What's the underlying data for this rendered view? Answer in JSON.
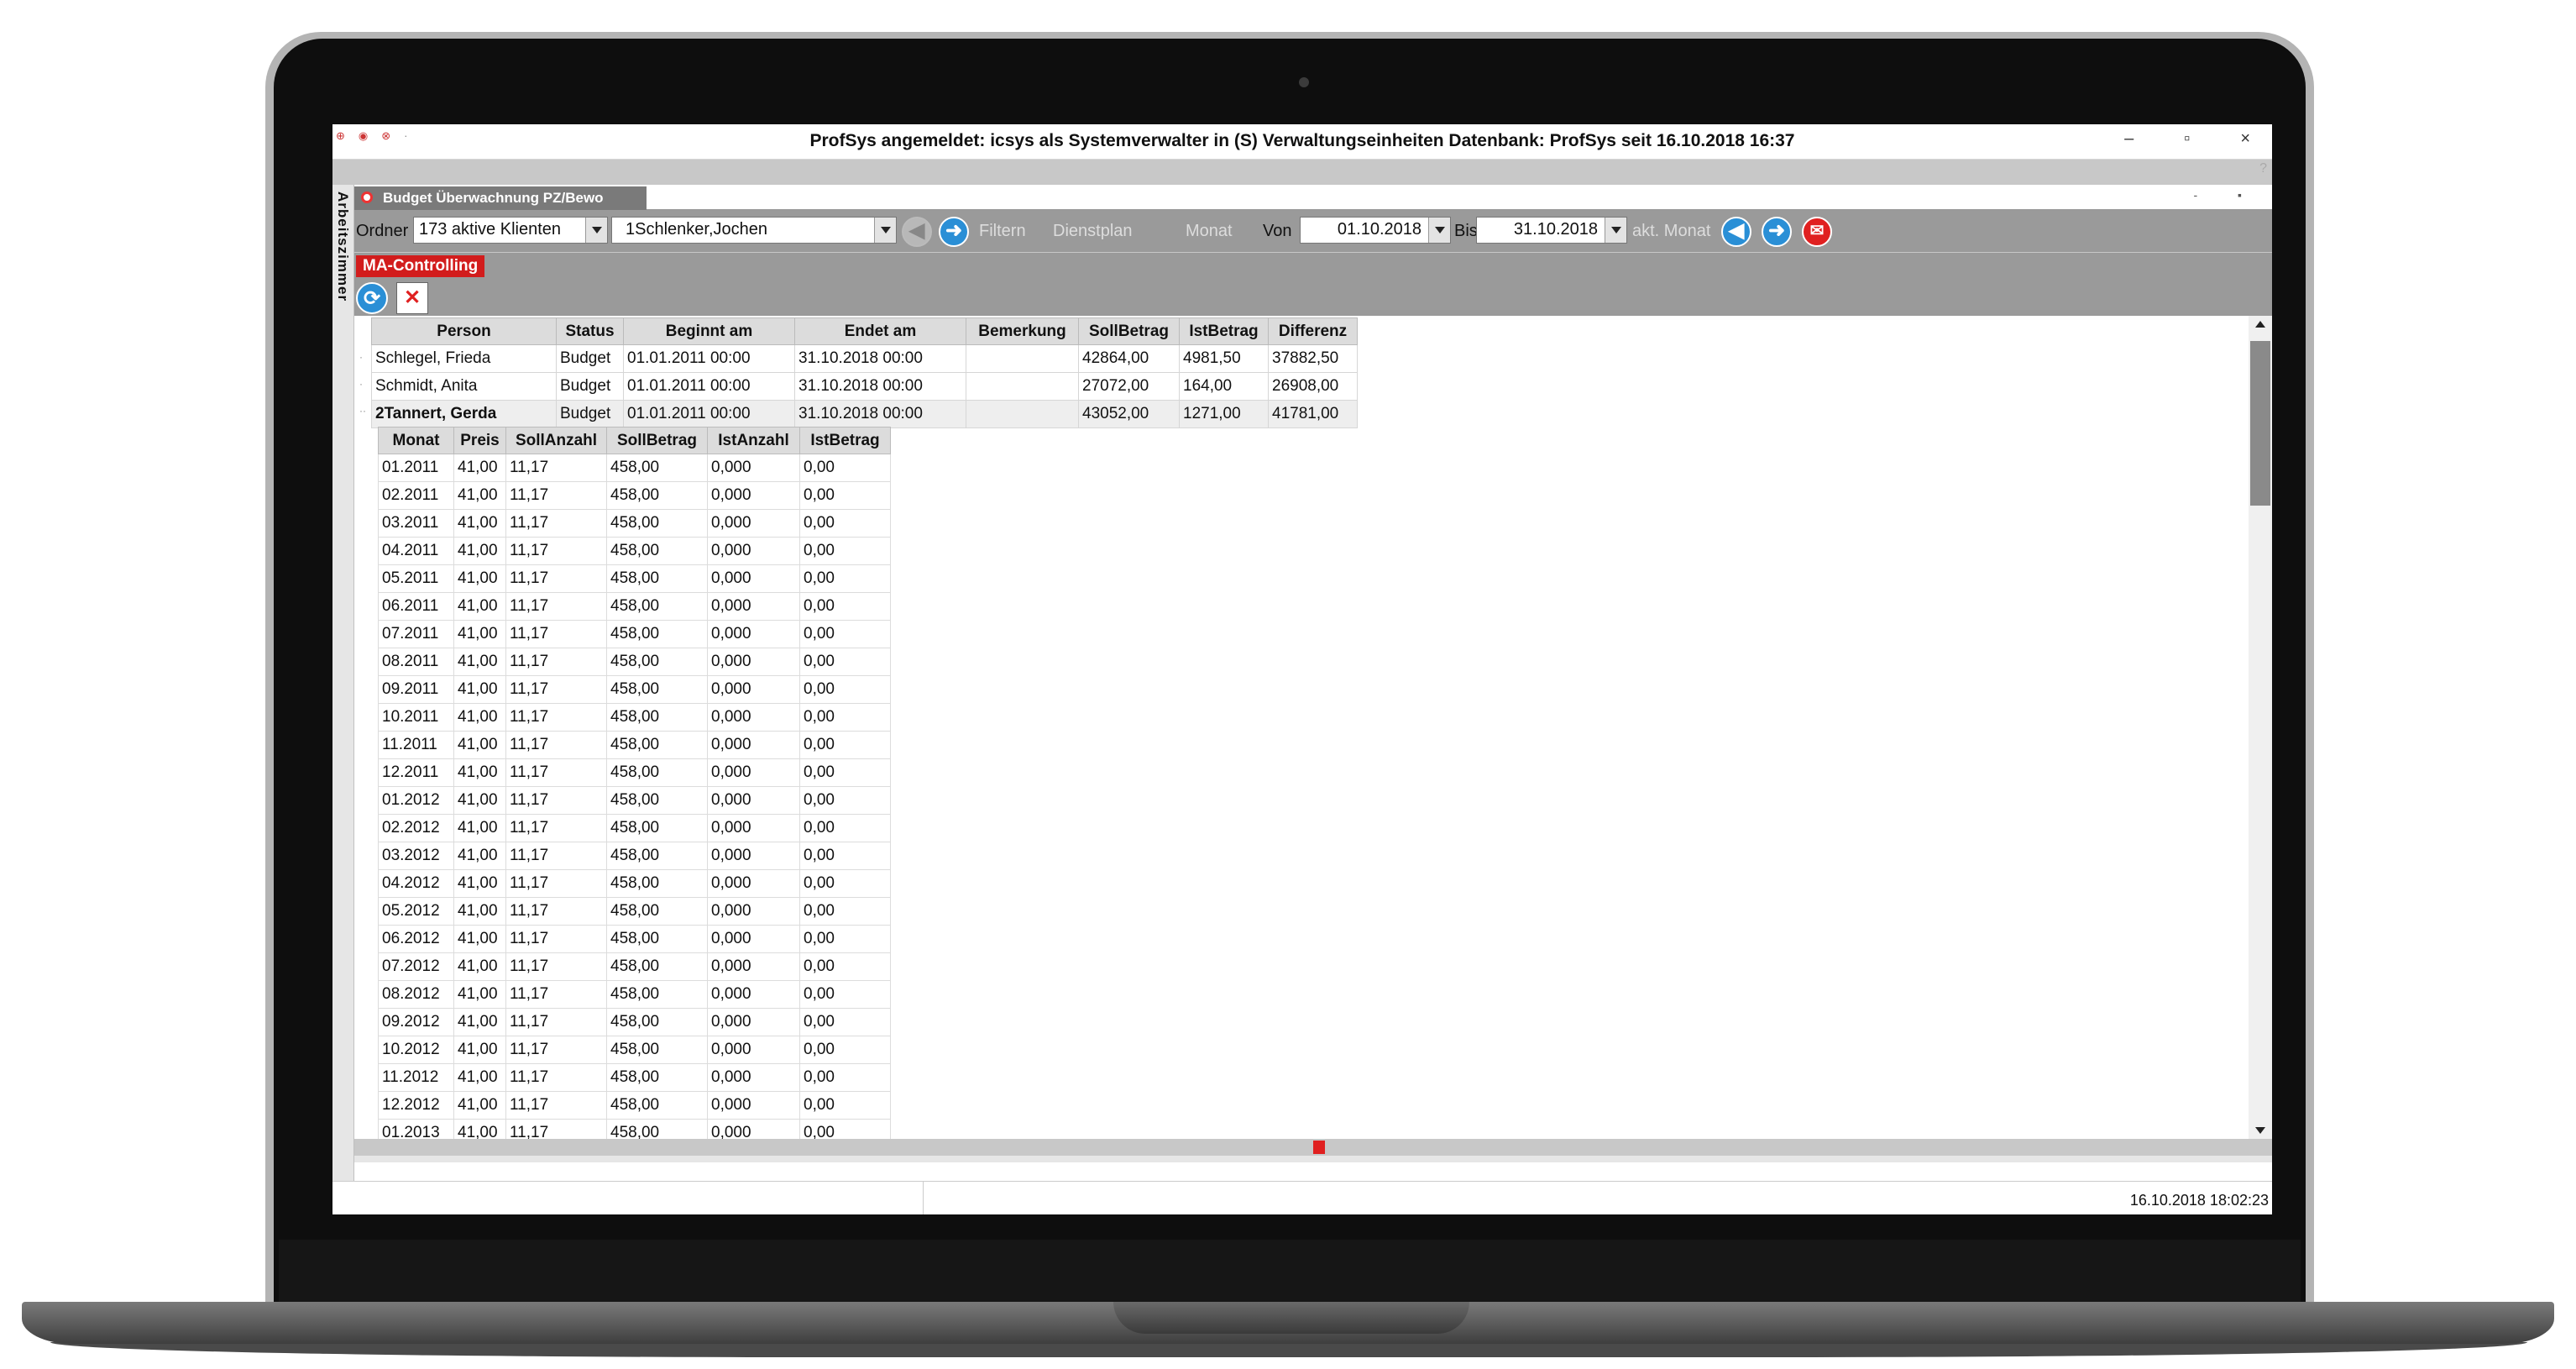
{
  "window": {
    "title": "ProfSys angemeldet: icsys als Systemverwalter in (S) Verwaltungseinheiten Datenbank: ProfSys seit 16.10.2018 16:37",
    "minimize": "–",
    "restore": "▫",
    "close": "×"
  },
  "sidebar": {
    "label": "Arbeitszimmer"
  },
  "document_tab": {
    "label": "Budget Überwachnung PZ/Bewo"
  },
  "toolbar": {
    "ordner_label": "Ordner",
    "ordner_value": "173 aktive Klienten",
    "person_value": "1Schlenker,Jochen",
    "filter_label": "Filtern",
    "dienstplan_label": "Dienstplan",
    "monat_label": "Monat",
    "von_label": "Von",
    "von_value": "01.10.2018",
    "bis_label": "Bis",
    "bis_value": "31.10.2018",
    "akt_monat_label": "akt. Monat"
  },
  "badge": {
    "label": "MA-Controlling"
  },
  "person_table": {
    "columns": [
      "Person",
      "Status",
      "Beginnt am",
      "Endet am",
      "Bemerkung",
      "SollBetrag",
      "IstBetrag",
      "Differenz"
    ],
    "rows": [
      [
        "Schlegel, Frieda",
        "Budget",
        "01.01.2011 00:00",
        "31.10.2018 00:00",
        "",
        "42864,00",
        "4981,50",
        "37882,50"
      ],
      [
        "Schmidt, Anita",
        "Budget",
        "01.01.2011 00:00",
        "31.10.2018 00:00",
        "",
        "27072,00",
        "164,00",
        "26908,00"
      ],
      [
        "2Tannert, Gerda",
        "Budget",
        "01.01.2011 00:00",
        "31.10.2018 00:00",
        "",
        "43052,00",
        "1271,00",
        "41781,00"
      ]
    ]
  },
  "month_table": {
    "columns": [
      "Monat",
      "Preis",
      "SollAnzahl",
      "SollBetrag",
      "IstAnzahl",
      "IstBetrag"
    ],
    "rows": [
      [
        "01.2011",
        "41,00",
        "11,17",
        "458,00",
        "0,000",
        "0,00"
      ],
      [
        "02.2011",
        "41,00",
        "11,17",
        "458,00",
        "0,000",
        "0,00"
      ],
      [
        "03.2011",
        "41,00",
        "11,17",
        "458,00",
        "0,000",
        "0,00"
      ],
      [
        "04.2011",
        "41,00",
        "11,17",
        "458,00",
        "0,000",
        "0,00"
      ],
      [
        "05.2011",
        "41,00",
        "11,17",
        "458,00",
        "0,000",
        "0,00"
      ],
      [
        "06.2011",
        "41,00",
        "11,17",
        "458,00",
        "0,000",
        "0,00"
      ],
      [
        "07.2011",
        "41,00",
        "11,17",
        "458,00",
        "0,000",
        "0,00"
      ],
      [
        "08.2011",
        "41,00",
        "11,17",
        "458,00",
        "0,000",
        "0,00"
      ],
      [
        "09.2011",
        "41,00",
        "11,17",
        "458,00",
        "0,000",
        "0,00"
      ],
      [
        "10.2011",
        "41,00",
        "11,17",
        "458,00",
        "0,000",
        "0,00"
      ],
      [
        "11.2011",
        "41,00",
        "11,17",
        "458,00",
        "0,000",
        "0,00"
      ],
      [
        "12.2011",
        "41,00",
        "11,17",
        "458,00",
        "0,000",
        "0,00"
      ],
      [
        "01.2012",
        "41,00",
        "11,17",
        "458,00",
        "0,000",
        "0,00"
      ],
      [
        "02.2012",
        "41,00",
        "11,17",
        "458,00",
        "0,000",
        "0,00"
      ],
      [
        "03.2012",
        "41,00",
        "11,17",
        "458,00",
        "0,000",
        "0,00"
      ],
      [
        "04.2012",
        "41,00",
        "11,17",
        "458,00",
        "0,000",
        "0,00"
      ],
      [
        "05.2012",
        "41,00",
        "11,17",
        "458,00",
        "0,000",
        "0,00"
      ],
      [
        "06.2012",
        "41,00",
        "11,17",
        "458,00",
        "0,000",
        "0,00"
      ],
      [
        "07.2012",
        "41,00",
        "11,17",
        "458,00",
        "0,000",
        "0,00"
      ],
      [
        "08.2012",
        "41,00",
        "11,17",
        "458,00",
        "0,000",
        "0,00"
      ],
      [
        "09.2012",
        "41,00",
        "11,17",
        "458,00",
        "0,000",
        "0,00"
      ],
      [
        "10.2012",
        "41,00",
        "11,17",
        "458,00",
        "0,000",
        "0,00"
      ],
      [
        "11.2012",
        "41,00",
        "11,17",
        "458,00",
        "0,000",
        "0,00"
      ],
      [
        "12.2012",
        "41,00",
        "11,17",
        "458,00",
        "0,000",
        "0,00"
      ],
      [
        "01.2013",
        "41,00",
        "11,17",
        "458,00",
        "0,000",
        "0,00"
      ]
    ]
  },
  "status": {
    "datetime": "16.10.2018 18:02:23"
  },
  "icons": {
    "back": "arrow-left-icon",
    "forward": "arrow-right-icon",
    "mail": "mail-icon",
    "refresh": "refresh-icon",
    "cancel": "close-icon"
  },
  "colors": {
    "accent_blue": "#2a8fd6",
    "accent_red": "#d21c1c",
    "toolbar_grey": "#9a9a9a"
  }
}
